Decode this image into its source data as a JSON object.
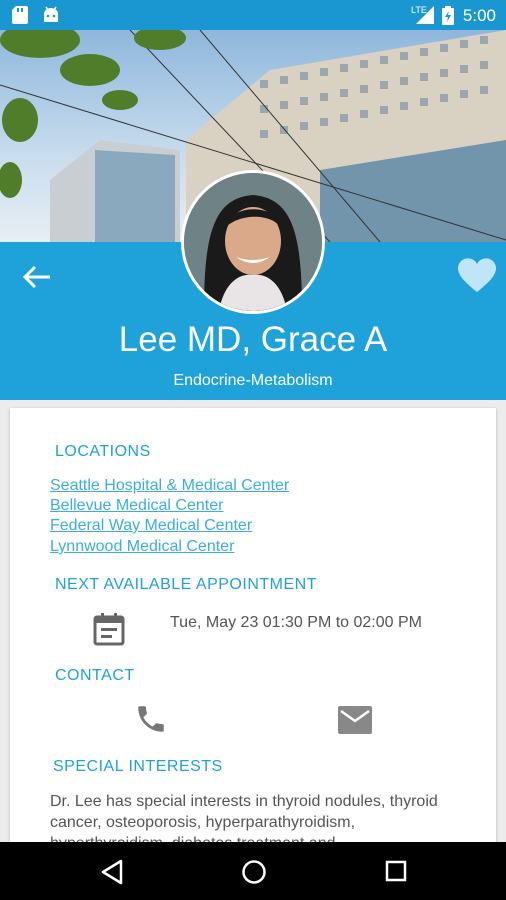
{
  "status_bar": {
    "time": "5:00",
    "network": "LTE"
  },
  "doctor": {
    "name": "Lee MD, Grace A",
    "specialty": "Endocrine-Metabolism"
  },
  "sections": {
    "locations": {
      "title": "LOCATIONS",
      "items": [
        "Seattle Hospital & Medical Center",
        "Bellevue Medical Center",
        "Federal Way Medical Center",
        "Lynnwood Medical Center"
      ]
    },
    "appointment": {
      "title": "NEXT AVAILABLE APPOINTMENT",
      "text": "Tue, May 23 01:30 PM to 02:00 PM"
    },
    "contact": {
      "title": "CONTACT"
    },
    "interests": {
      "title": "SPECIAL INTERESTS",
      "text": "Dr. Lee has special interests in thyroid nodules, thyroid cancer, osteoporosis, hyperparathyroidism, hyperthyroidism, diabetes treatment and"
    }
  },
  "colors": {
    "accent": "#1ea2d9",
    "status_bar": "#1a97d0",
    "heart": "#bfe6f7"
  }
}
